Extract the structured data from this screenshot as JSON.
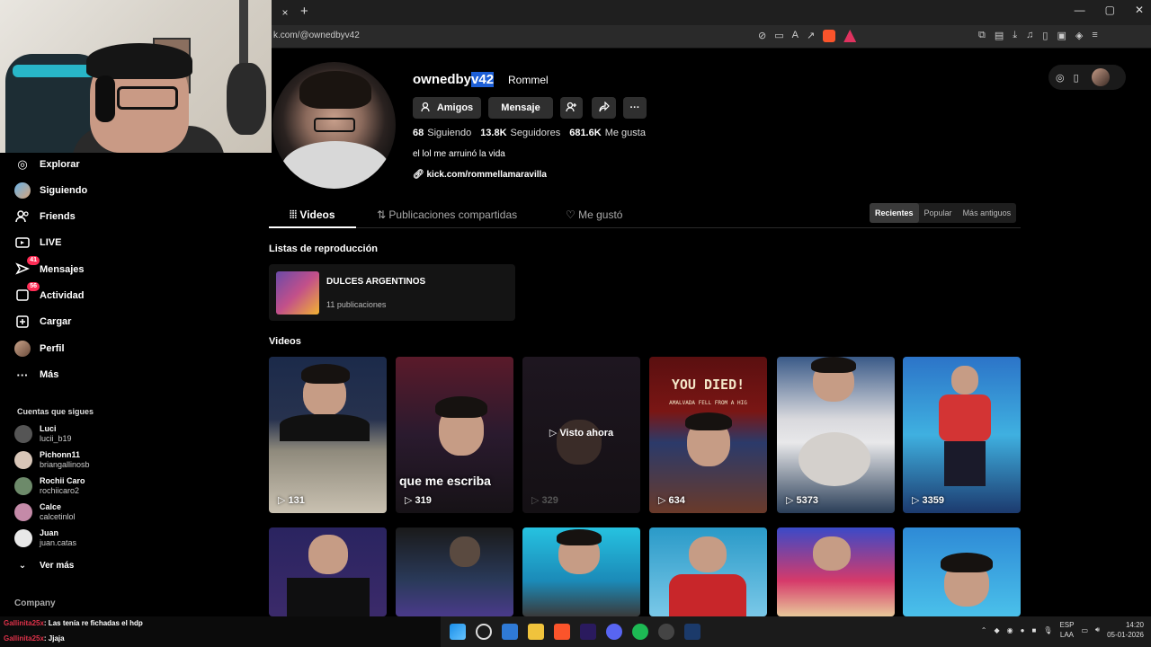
{
  "browser": {
    "tab_close": "×",
    "tab_new": "+",
    "url": "k.com/@ownedbyv42",
    "window_controls": [
      "—",
      "▢",
      "✕"
    ]
  },
  "sidebar": {
    "items": [
      {
        "label": "Explorar",
        "icon": "compass-icon",
        "glyph": "◎"
      },
      {
        "label": "Siguiendo",
        "icon": "following-avatar",
        "glyph": ""
      },
      {
        "label": "Friends",
        "icon": "friends-icon",
        "glyph": "👥"
      },
      {
        "label": "LIVE",
        "icon": "live-icon",
        "glyph": "▣"
      },
      {
        "label": "Mensajes",
        "icon": "messages-icon",
        "glyph": "➤",
        "badge": "41"
      },
      {
        "label": "Actividad",
        "icon": "activity-icon",
        "glyph": "▢",
        "badge": "56"
      },
      {
        "label": "Cargar",
        "icon": "upload-icon",
        "glyph": "⊞"
      },
      {
        "label": "Perfil",
        "icon": "profile-avatar",
        "glyph": ""
      },
      {
        "label": "Más",
        "icon": "more-icon",
        "glyph": "···"
      }
    ],
    "following_title": "Cuentas que sigues",
    "following": [
      {
        "name": "Luci",
        "user": "lucii_b19",
        "color": "#444"
      },
      {
        "name": "Pichonn11",
        "user": "briangallinosb",
        "color": "#d8c6b8"
      },
      {
        "name": "Rochii Caro",
        "user": "rochiicaro2",
        "color": "#6d8a6a"
      },
      {
        "name": "Calce",
        "user": "calcetinlol",
        "color": "#c48aa8"
      },
      {
        "name": "Juan",
        "user": "juan.catas",
        "color": "#e8e8e8"
      }
    ],
    "see_more": "Ver más",
    "company": "Company"
  },
  "profile": {
    "username_pre": "ownedby",
    "username_hl": "v42",
    "nickname": "Rommel",
    "buttons": {
      "friends": "Amigos",
      "message": "Mensaje"
    },
    "stats": [
      {
        "value": "68",
        "label": "Siguiendo"
      },
      {
        "value": "13.8K",
        "label": "Seguidores"
      },
      {
        "value": "681.6K",
        "label": "Me gusta"
      }
    ],
    "bio": "el lol me arruinó la vida",
    "link": "kick.com/rommellamaravilla"
  },
  "tabs": [
    {
      "label": "Videos",
      "active": true
    },
    {
      "label": "Publicaciones compartidas",
      "active": false
    },
    {
      "label": "Me gustó",
      "active": false
    }
  ],
  "sort": [
    "Recientes",
    "Popular",
    "Más antiguos"
  ],
  "playlists": {
    "title": "Listas de reproducción",
    "items": [
      {
        "title": "DULCES ARGENTINOS",
        "count": "11 publicaciones"
      }
    ]
  },
  "videos": {
    "title": "Videos",
    "row1": [
      {
        "views": "131"
      },
      {
        "views": "319",
        "caption": "que me escriba"
      },
      {
        "views": "329",
        "overlay": "Visto ahora"
      },
      {
        "views": "634",
        "died": "YOU DIED!",
        "died_sub": "AMALVADA FELL FROM A HIG"
      },
      {
        "views": "5373"
      },
      {
        "views": "3359"
      }
    ]
  },
  "chat": [
    {
      "user": "Gallinita25x",
      "text": ": Las tenía re fichadas el hdp"
    },
    {
      "user": "Gallinita25x",
      "text": ": Jjaja"
    }
  ],
  "tray": {
    "lang1": "ESP",
    "lang2": "LAA",
    "time": "14:20",
    "date": "05-01-2026"
  },
  "colors": {
    "accent": "#fe2c55",
    "selection": "#1d5fd6",
    "chat_user": "#e0324a"
  }
}
